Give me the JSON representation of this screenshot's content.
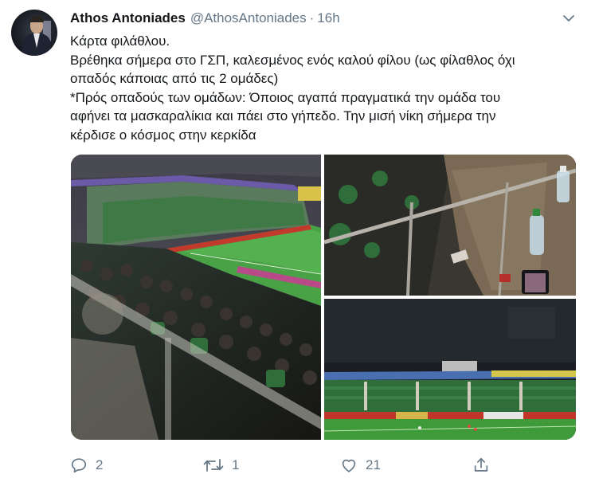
{
  "author": {
    "name": "Athos Antoniades",
    "handle": "@AthosAntoniades",
    "separator": "·",
    "time": "16h"
  },
  "tweet_lines": [
    "Κάρτα φιλάθλου.",
    "Βρέθηκα σήμερα στο ΓΣΠ, καλεσμένος ενός καλού φίλου (ως φίλαθλος όχι",
    "οπαδός κάποιας από τις 2 ομάδες)",
    "*Πρός οπαδούς των ομάδων: Όποιος αγαπά πραγματικά την ομάδα του",
    "αφήνει τα μασκαραλίκια και πάει στο γήπεδο. Την μισή νίκη σήμερα την",
    "κέρδισε ο κόσμος στην κερκίδα"
  ],
  "actions": {
    "replies": "2",
    "retweets": "1",
    "likes": "21"
  },
  "icons": {
    "reply": "reply-icon",
    "retweet": "retweet-icon",
    "like": "like-icon",
    "share": "share-icon",
    "menu": "chevron-down-icon"
  },
  "colors": {
    "text": "#14171a",
    "secondary": "#657786",
    "pitch": "#3f9a3a",
    "fans": "#2f6e3a"
  }
}
